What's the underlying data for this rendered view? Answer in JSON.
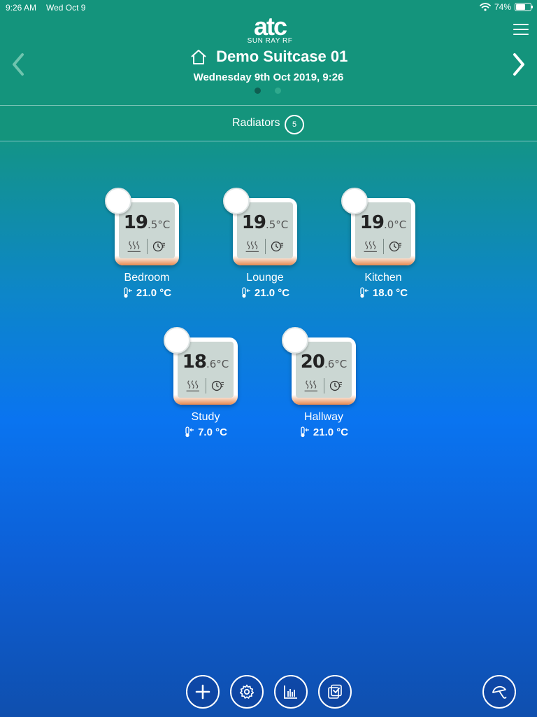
{
  "status_bar": {
    "time": "9:26 AM",
    "date": "Wed Oct 9",
    "battery": "74%",
    "battery_level": 0.74
  },
  "logo": {
    "mark": "atc",
    "sub": "SUN RAY RF"
  },
  "header": {
    "title": "Demo Suitcase 01",
    "subtitle": "Wednesday 9th Oct 2019, 9:26",
    "page_count": 2,
    "active_page": 1
  },
  "tabbar": {
    "label": "Radiators",
    "count": "5"
  },
  "radiators": [
    {
      "name": "Bedroom",
      "temp_whole": "19",
      "temp_dec": ".5",
      "unit": "°C",
      "target": "21.0 °C"
    },
    {
      "name": "Lounge",
      "temp_whole": "19",
      "temp_dec": ".5",
      "unit": "°C",
      "target": "21.0 °C"
    },
    {
      "name": "Kitchen",
      "temp_whole": "19",
      "temp_dec": ".0",
      "unit": "°C",
      "target": "18.0 °C"
    },
    {
      "name": "Study",
      "temp_whole": "18",
      "temp_dec": ".6",
      "unit": "°C",
      "target": "7.0 °C"
    },
    {
      "name": "Hallway",
      "temp_whole": "20",
      "temp_dec": ".6",
      "unit": "°C",
      "target": "21.0 °C"
    }
  ],
  "toolbar": {
    "add": "plus-icon",
    "settings": "gear-icon",
    "stats": "bar-chart-icon",
    "schedule": "checklist-icon",
    "away": "umbrella-icon"
  },
  "colors": {
    "header": "#14947c",
    "accent_orange": "#e7894f",
    "screen": "#cbd7d3"
  }
}
